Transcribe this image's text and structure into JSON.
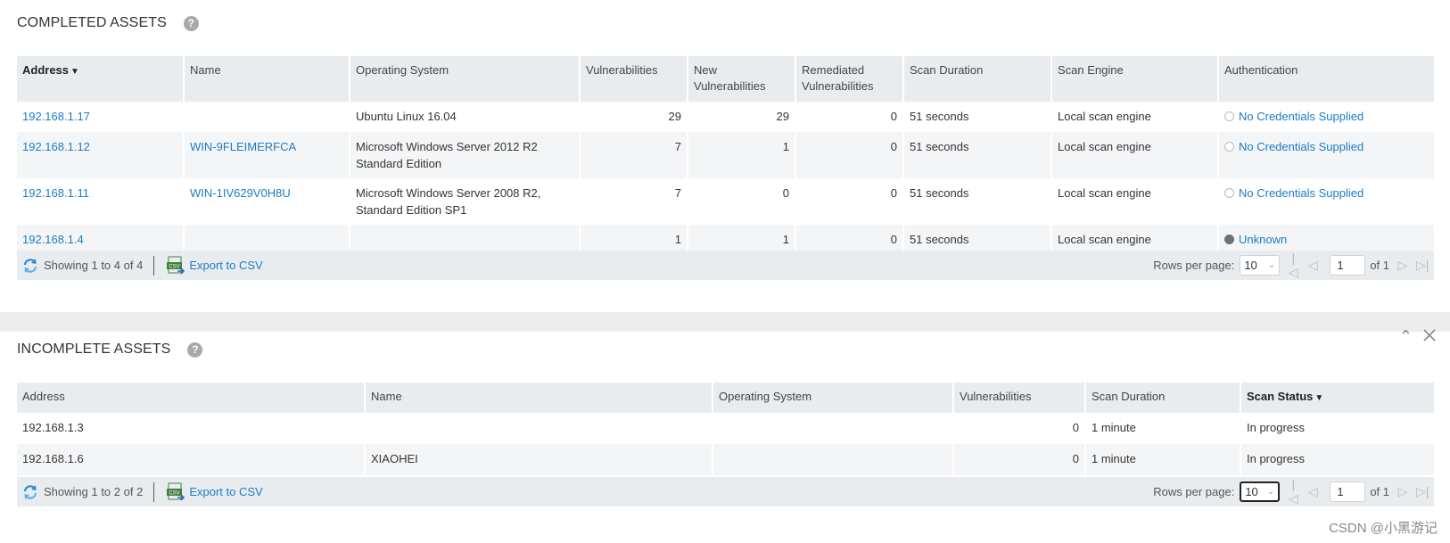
{
  "completed": {
    "title": "COMPLETED ASSETS",
    "help_glyph": "?",
    "columns": [
      "Address",
      "Name",
      "Operating System",
      "Vulnerabilities",
      "New Vulnerabilities",
      "Remediated Vulnerabilities",
      "Scan Duration",
      "Scan Engine",
      "Authentication"
    ],
    "sorted_column": "Address",
    "rows": [
      {
        "address": "192.168.1.17",
        "name": "",
        "os": "Ubuntu Linux 16.04",
        "vulns": "29",
        "new_vulns": "29",
        "remediated": "0",
        "duration": "51 seconds",
        "engine": "Local scan engine",
        "auth": "No Credentials Supplied"
      },
      {
        "address": "192.168.1.12",
        "name": "WIN-9FLEIMERFCA",
        "os": "Microsoft Windows Server 2012 R2 Standard Edition",
        "vulns": "7",
        "new_vulns": "1",
        "remediated": "0",
        "duration": "51 seconds",
        "engine": "Local scan engine",
        "auth": "No Credentials Supplied"
      },
      {
        "address": "192.168.1.11",
        "name": "WIN-1IV629V0H8U",
        "os": "Microsoft Windows Server 2008 R2, Standard Edition SP1",
        "vulns": "7",
        "new_vulns": "0",
        "remediated": "0",
        "duration": "51 seconds",
        "engine": "Local scan engine",
        "auth": "No Credentials Supplied"
      },
      {
        "address": "192.168.1.4",
        "name": "",
        "os": "",
        "vulns": "1",
        "new_vulns": "1",
        "remediated": "0",
        "duration": "51 seconds",
        "engine": "Local scan engine",
        "auth": "Unknown"
      }
    ],
    "footer": {
      "showing": "Showing 1 to 4 of 4",
      "export": "Export to CSV",
      "rows_per_page_label": "Rows per page:",
      "rows_per_page": "10",
      "page": "1",
      "of_pages": "of 1"
    }
  },
  "incomplete": {
    "title": "INCOMPLETE ASSETS",
    "help_glyph": "?",
    "columns": [
      "Address",
      "Name",
      "Operating System",
      "Vulnerabilities",
      "Scan Duration",
      "Scan Status"
    ],
    "sorted_column": "Scan Status",
    "rows": [
      {
        "address": "192.168.1.3",
        "name": "",
        "os": "",
        "vulns": "0",
        "duration": "1 minute",
        "status": "In progress"
      },
      {
        "address": "192.168.1.6",
        "name": "XIAOHEI",
        "os": "",
        "vulns": "0",
        "duration": "1 minute",
        "status": "In progress"
      }
    ],
    "footer": {
      "showing": "Showing 1 to 2 of 2",
      "export": "Export to CSV",
      "rows_per_page_label": "Rows per page:",
      "rows_per_page": "10",
      "page": "1",
      "of_pages": "of 1"
    }
  },
  "icons": {
    "help": "help-circle-icon",
    "refresh": "refresh-icon",
    "csv": "csv-file-icon",
    "first": "first-page-icon",
    "prev": "prev-page-icon",
    "next": "next-page-icon",
    "last": "last-page-icon",
    "collapse": "chevron-up-icon",
    "close": "close-icon"
  },
  "colors": {
    "link": "#1b7cc4",
    "header_bg": "#e9ecef",
    "alt_row_bg": "#f4f5f7",
    "divider_bg": "#ecedef"
  },
  "watermark": "CSDN @小黑游记"
}
